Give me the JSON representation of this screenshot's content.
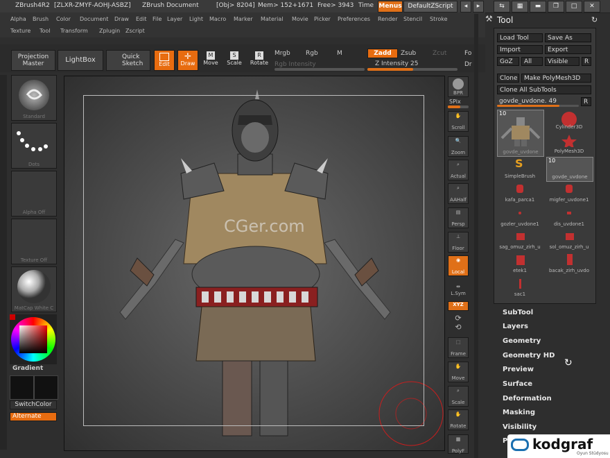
{
  "titlebar": {
    "app": "ZBrush4R2",
    "serial": "[ZLXR-ZMYF-AOHJ-ASBZ]",
    "document": "ZBrush Document",
    "obj": "[Obj> 8204]",
    "mem": "Mem> 152+1671",
    "free": "Free> 3943",
    "time": "Time",
    "menus_button": "Menus",
    "script_button": "DefaultZScript"
  },
  "menubar": {
    "row1": [
      "Alpha",
      "Brush",
      "Color",
      "Document",
      "Draw",
      "Edit",
      "File",
      "Layer",
      "Light",
      "Macro",
      "Marker",
      "Material",
      "Movie",
      "Picker",
      "Preferences",
      "Render",
      "Stencil",
      "Stroke"
    ],
    "row2": [
      "Texture",
      "Tool",
      "Transform",
      "Zplugin",
      "Zscript"
    ]
  },
  "toolbar": {
    "projection_master": "Projection Master",
    "lightbox": "LightBox",
    "quick_sketch": "Quick Sketch",
    "edit": "Edit",
    "draw": "Draw",
    "move": "Move",
    "scale": "Scale",
    "rotate": "Rotate",
    "mrgb": "Mrgb",
    "rgb": "Rgb",
    "m": "M",
    "rgb_intensity": "Rgb Intensity",
    "zadd": "Zadd",
    "zsub": "Zsub",
    "zcut": "Zcut",
    "z_intensity": "Z Intensity 25",
    "z_intensity_value": 25,
    "focal": "Fo",
    "draw_size": "Dr"
  },
  "leftshelf": {
    "brush": "Standard",
    "stroke": "Dots",
    "alpha": "Alpha Off",
    "texture": "Texture Off",
    "material": "MatCap White C",
    "gradient": "Gradient",
    "switchcolor": "SwitchColor",
    "alternate": "Alternate"
  },
  "watermark": "CGer.com",
  "rightshelf": {
    "bpr": "BPR",
    "spix": "SPix",
    "scroll": "Scroll",
    "zoom": "Zoom",
    "actual": "Actual",
    "aahalf": "AAHalf",
    "persp": "Persp",
    "floor": "Floor",
    "local": "Local",
    "lsym": "L.Sym",
    "xyz": "XYZ",
    "frame": "Frame",
    "move": "Move",
    "scale": "Scale",
    "rotate": "Rotate",
    "polyf": "PolyF"
  },
  "toolpanel": {
    "title": "Tool",
    "load_tool": "Load Tool",
    "save_as": "Save As",
    "import": "Import",
    "export": "Export",
    "goz": "GoZ",
    "all": "All",
    "visible": "Visible",
    "r": "R",
    "clone": "Clone",
    "make_polymesh": "Make PolyMesh3D",
    "clone_all": "Clone All SubTools",
    "current_tool": "govde_uvdone. 49",
    "r2": "R",
    "count1": "10",
    "count2": "10",
    "subtools": [
      "govde_uvdone",
      "Cylinder3D",
      "PolyMesh3D",
      "SimpleBrush",
      "govde_uvdone",
      "kafa_parca1",
      "migfer_uvdone1",
      "gozler_uvdone1",
      "dis_uvdone1",
      "sag_omuz_zirh_u",
      "sol_omuz_zirh_u",
      "etek1",
      "bacak_zirh_uvdo",
      "sac1"
    ]
  },
  "sections": [
    "SubTool",
    "Layers",
    "Geometry",
    "Geometry HD",
    "Preview",
    "Surface",
    "Deformation",
    "Masking",
    "Visibility",
    "P"
  ],
  "logo": {
    "name": "kodgraf",
    "tagline": "Oyun Stüdyosu"
  },
  "colors": {
    "accent": "#e07018",
    "panel": "#3a3a3a",
    "background": "#2e2e2e"
  }
}
